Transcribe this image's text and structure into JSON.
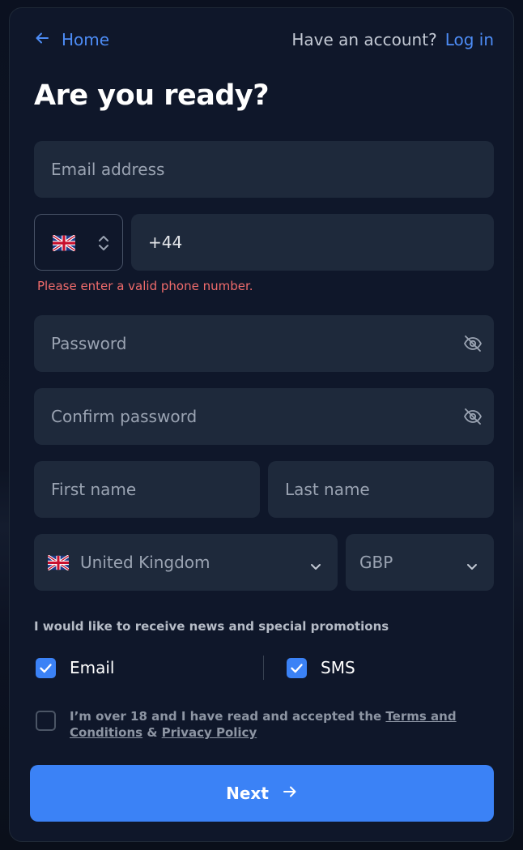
{
  "nav": {
    "home_label": "Home",
    "account_question": "Have an account?",
    "login_label": "Log in"
  },
  "title": "Are you ready?",
  "form": {
    "email_placeholder": "Email address",
    "phone_country_flag": "uk-flag-icon",
    "phone_value": "+44",
    "phone_error": "Please enter a valid phone number.",
    "password_placeholder": "Password",
    "confirm_password_placeholder": "Confirm password",
    "first_name_placeholder": "First name",
    "last_name_placeholder": "Last name",
    "country_value": "United Kingdom",
    "currency_value": "GBP"
  },
  "promotions": {
    "heading": "I would like to receive news and special promotions",
    "email_label": "Email",
    "email_checked": true,
    "sms_label": "SMS",
    "sms_checked": true
  },
  "terms": {
    "checked": false,
    "text_prefix": "I’m over 18 and I have read and accepted the ",
    "terms_link": "Terms and Conditions",
    "separator": " & ",
    "privacy_link": "Privacy Policy"
  },
  "next_label": "Next",
  "colors": {
    "accent": "#3b82f6",
    "error": "#ef6b6b",
    "field_bg": "#1e293b",
    "card_bg": "#0f172a"
  }
}
